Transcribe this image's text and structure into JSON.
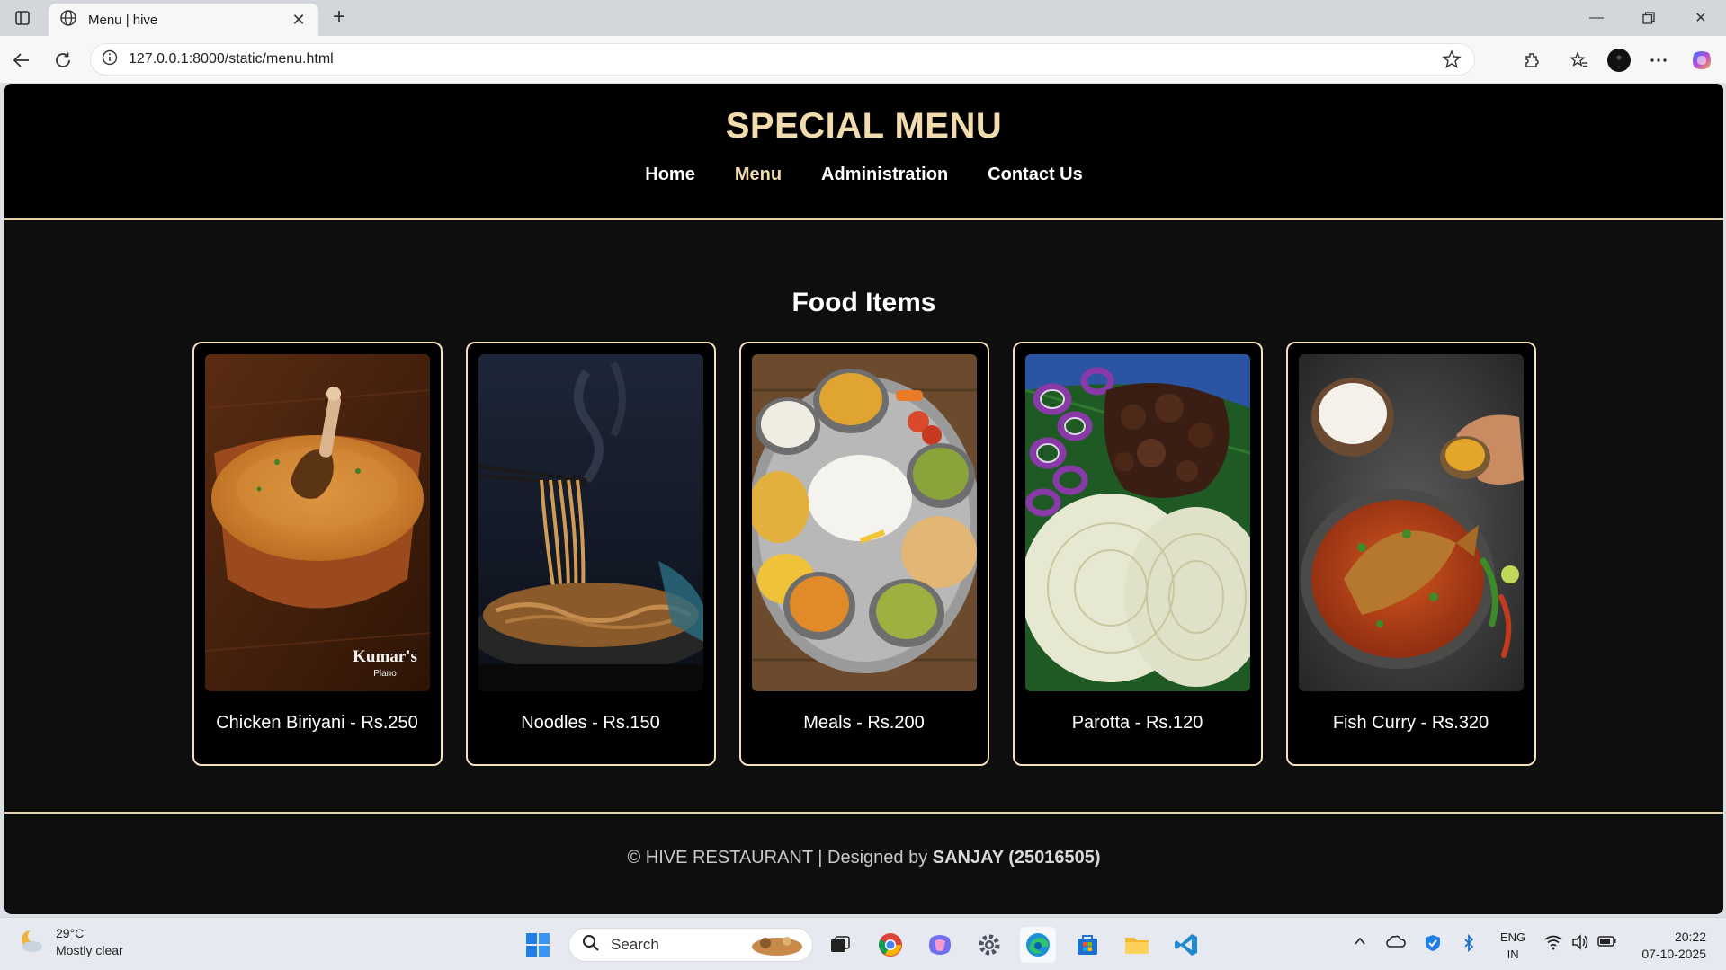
{
  "browser": {
    "tab_title": "Menu | hive",
    "url": "127.0.0.1:8000/static/menu.html"
  },
  "site": {
    "title": "SPECIAL MENU",
    "nav": [
      {
        "label": "Home"
      },
      {
        "label": "Menu"
      },
      {
        "label": "Administration"
      },
      {
        "label": "Contact Us"
      }
    ],
    "section_title": "Food Items",
    "items": [
      {
        "caption": "Chicken Biriyani - Rs.250",
        "image_watermark": "Kumar's",
        "image_watermark_sub": "Plano"
      },
      {
        "caption": "Noodles - Rs.150"
      },
      {
        "caption": "Meals - Rs.200"
      },
      {
        "caption": "Parotta - Rs.120"
      },
      {
        "caption": "Fish Curry - Rs.320"
      }
    ],
    "footer_prefix": "© HIVE RESTAURANT | Designed by ",
    "footer_author": "SANJAY (25016505)"
  },
  "taskbar": {
    "temperature": "29°C",
    "weather": "Mostly clear",
    "search_placeholder": "Search",
    "lang_line1": "ENG",
    "lang_line2": "IN",
    "time": "20:22",
    "date": "07-10-2025"
  },
  "colors": {
    "accent_gold": "#f2dcae",
    "border_gold": "#e8d2a6",
    "page_bg": "#0e0e0e"
  }
}
